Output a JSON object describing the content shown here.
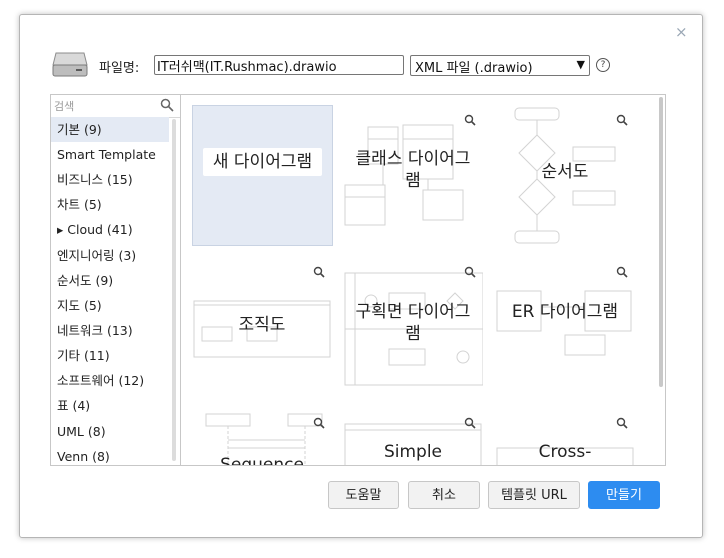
{
  "dialog": {
    "close_label": "×",
    "filename_label": "파일명:",
    "filename_value": "IT러쉬맥(IT.Rushmac).drawio",
    "filetype_value": "XML 파일 (.drawio)",
    "help_label": "?"
  },
  "search": {
    "placeholder": "검색"
  },
  "categories": [
    {
      "label": "기본 (9)"
    },
    {
      "label": "Smart Template"
    },
    {
      "label": "비즈니스 (15)"
    },
    {
      "label": "차트 (5)"
    },
    {
      "label": "▸ Cloud (41)"
    },
    {
      "label": "엔지니어링 (3)"
    },
    {
      "label": "순서도 (9)"
    },
    {
      "label": "지도 (5)"
    },
    {
      "label": "네트워크 (13)"
    },
    {
      "label": "기타 (11)"
    },
    {
      "label": "소프트웨어 (12)"
    },
    {
      "label": "표 (4)"
    },
    {
      "label": "UML (8)"
    },
    {
      "label": "Venn (8)"
    }
  ],
  "templates": [
    {
      "label": "새 다이어그램"
    },
    {
      "label": "클래스 다이어그램"
    },
    {
      "label": "순서도"
    },
    {
      "label": "조직도"
    },
    {
      "label": "구획면 다이어그램"
    },
    {
      "label": "ER 다이어그램"
    },
    {
      "label": "Sequence"
    },
    {
      "label": "Simple"
    },
    {
      "label": "Cross-"
    }
  ],
  "buttons": {
    "help": "도움말",
    "cancel": "취소",
    "template_url": "템플릿 URL",
    "create": "만들기"
  }
}
